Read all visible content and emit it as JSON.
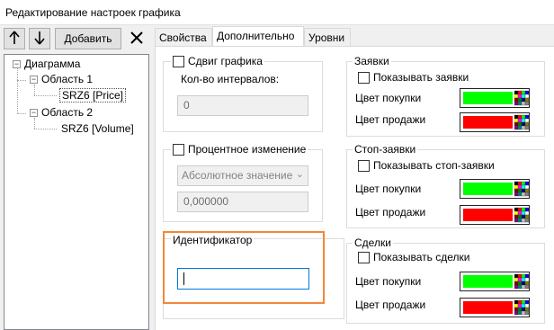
{
  "window": {
    "title": "Редактирование настроек графика"
  },
  "toolbar": {
    "up_icon": "arrow-up-icon",
    "down_icon": "arrow-down-icon",
    "add_label": "Добавить",
    "delete_icon": "close-icon"
  },
  "tree": {
    "root": "Диаграмма",
    "areas": [
      {
        "label": "Область 1",
        "child": "SRZ6 [Price]"
      },
      {
        "label": "Область 2",
        "child": "SRZ6 [Volume]"
      }
    ]
  },
  "tabs": [
    {
      "label": "Свойства",
      "active": false
    },
    {
      "label": "Дополнительно",
      "active": true
    },
    {
      "label": "Уровни",
      "active": false
    }
  ],
  "shift": {
    "checkbox_label": "Сдвиг графика",
    "intervals_label": "Кол-во интервалов:",
    "intervals_value": "0"
  },
  "percent": {
    "checkbox_label": "Процентное изменение",
    "mode_value": "Абсолютное значение",
    "value": "0,000000"
  },
  "identifier": {
    "title": "Идентификатор",
    "value": ""
  },
  "orders": {
    "title": "Заявки",
    "show_label": "Показывать заявки",
    "buy_label": "Цвет покупки",
    "sell_label": "Цвет продажи",
    "buy_color": "#00ff00",
    "sell_color": "#ff0000"
  },
  "stop_orders": {
    "title": "Стоп-заявки",
    "show_label": "Показывать стоп-заявки",
    "buy_label": "Цвет покупки",
    "sell_label": "Цвет продажи",
    "buy_color": "#00ff00",
    "sell_color": "#ff0000"
  },
  "trades": {
    "title": "Сделки",
    "show_label": "Показывать сделки",
    "buy_label": "Цвет покупки",
    "sell_label": "Цвет продажи",
    "buy_color": "#00ff00",
    "sell_color": "#ff0000"
  },
  "highlight_color": "#f0883a"
}
